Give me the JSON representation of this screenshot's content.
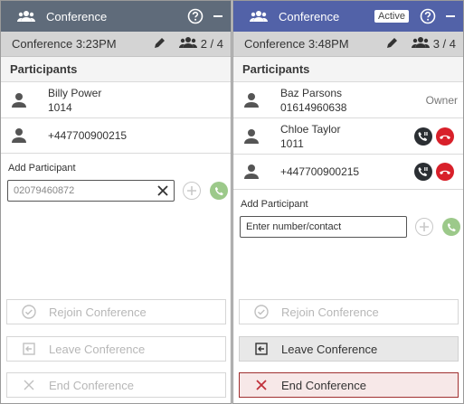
{
  "left": {
    "header_title": "Conference",
    "conference_name": "Conference 3:23PM",
    "participant_count": "2 / 4",
    "section_title": "Participants",
    "participants": [
      {
        "name": "Billy Power",
        "number": "1014"
      },
      {
        "name": "",
        "number": "+447700900215"
      }
    ],
    "add_label": "Add Participant",
    "add_input_value": "02079460872",
    "buttons": {
      "rejoin": "Rejoin Conference",
      "leave": "Leave Conference",
      "end": "End Conference"
    }
  },
  "right": {
    "header_title": "Conference",
    "status_badge": "Active",
    "conference_name": "Conference 3:48PM",
    "participant_count": "3 / 4",
    "section_title": "Participants",
    "participants": [
      {
        "name": "Baz Parsons",
        "number": "01614960638",
        "role": "Owner"
      },
      {
        "name": "Chloe Taylor",
        "number": "1011"
      },
      {
        "name": "",
        "number": "+447700900215"
      }
    ],
    "add_label": "Add Participant",
    "add_input_placeholder": "Enter number/contact",
    "buttons": {
      "rejoin": "Rejoin Conference",
      "leave": "Leave Conference",
      "end": "End Conference"
    }
  },
  "colors": {
    "left_header": "#5f6b7a",
    "right_header": "#5262a8",
    "hangup_red": "#d8202a",
    "call_green": "#9cc98a"
  },
  "icons": [
    "group-icon",
    "help-icon",
    "minimize-icon",
    "edit-icon",
    "participants-icon",
    "person-icon",
    "hold-icon",
    "hangup-icon",
    "clear-icon",
    "add-icon",
    "call-icon",
    "check-circle-icon",
    "leave-icon",
    "close-icon"
  ]
}
